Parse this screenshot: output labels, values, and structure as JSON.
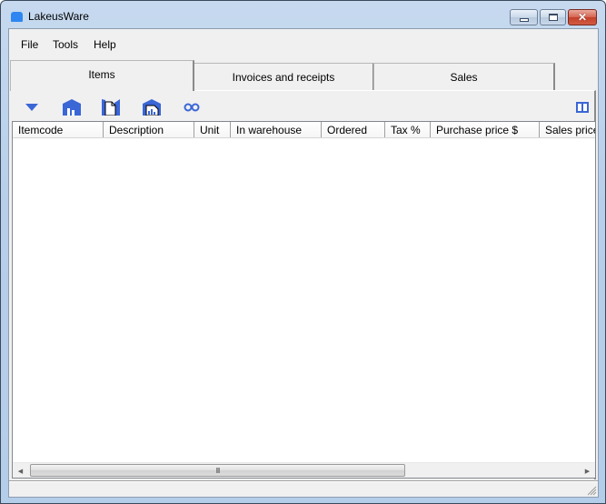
{
  "window": {
    "title": "LakeusWare",
    "icon": "app-icon",
    "controls": {
      "minimize": "minimize",
      "maximize": "maximize",
      "close": "✕"
    }
  },
  "menu": {
    "items": [
      {
        "label": "File"
      },
      {
        "label": "Tools"
      },
      {
        "label": "Help"
      }
    ]
  },
  "tabs": [
    {
      "label": "Items",
      "active": true
    },
    {
      "label": "Invoices and receipts",
      "active": false
    },
    {
      "label": "Sales",
      "active": false
    }
  ],
  "toolbar": {
    "icons": [
      "dropdown-arrow-icon",
      "warehouse-icon",
      "document-icon",
      "warehouse-report-icon",
      "link-icon",
      "columns-icon"
    ],
    "accent_color": "#3a66d6"
  },
  "grid": {
    "columns": [
      {
        "label": "Itemcode"
      },
      {
        "label": "Description"
      },
      {
        "label": "Unit"
      },
      {
        "label": "In warehouse"
      },
      {
        "label": "Ordered"
      },
      {
        "label": "Tax %"
      },
      {
        "label": "Purchase price $"
      },
      {
        "label": "Sales price"
      }
    ],
    "rows": [],
    "scroll": {
      "thumb_glyph": "III",
      "left_arrow": "◀",
      "right_arrow": "▶"
    }
  }
}
